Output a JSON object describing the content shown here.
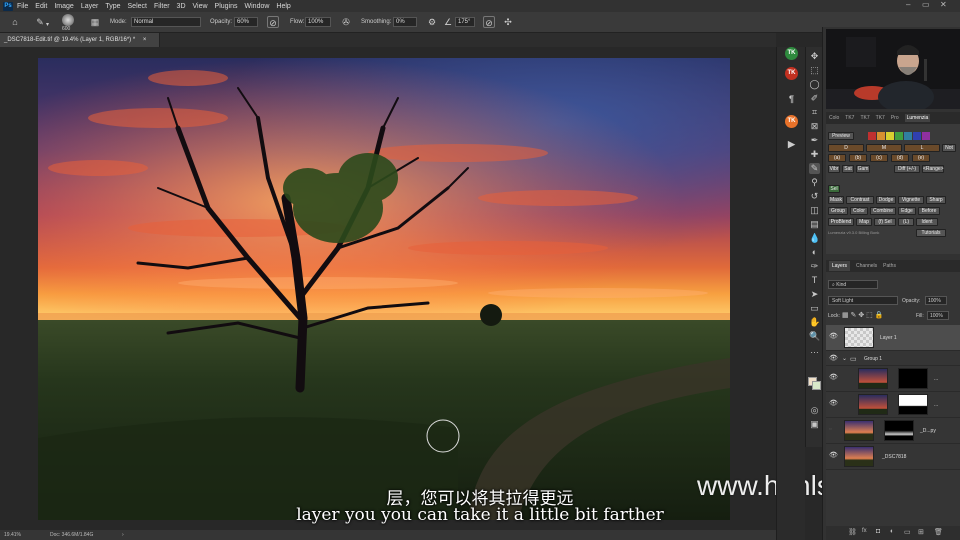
{
  "menubar": {
    "logo": "Ps",
    "items": [
      "File",
      "Edit",
      "Image",
      "Layer",
      "Type",
      "Select",
      "Filter",
      "3D",
      "View",
      "Plugins",
      "Window",
      "Help"
    ]
  },
  "options": {
    "brush_size": "600",
    "mode_label": "Mode:",
    "mode_value": "Normal",
    "opacity_label": "Opacity:",
    "opacity_value": "60%",
    "flow_label": "Flow:",
    "flow_value": "100%",
    "smoothing_label": "Smoothing:",
    "smoothing_value": "0%",
    "angle_value": "175°"
  },
  "document": {
    "tab_title": "_DSC7818-Edit.tif @ 19.4% (Layer 1, RGB/16*) *",
    "close": "×"
  },
  "status": {
    "zoom": "19.41%",
    "doc": "Doc: 346.6M/1.84G"
  },
  "subtitles": {
    "zh": "层，您可以将其拉得更远",
    "en": "layer you you can take it a little bit farther"
  },
  "watermark": "www.hunls.com",
  "plugin_badges": [
    "TK",
    "TK",
    "TK"
  ],
  "lumenzia": {
    "tabs": [
      "Colo",
      "TK7",
      "TK7",
      "TK7",
      "Pro",
      "Lumenzia"
    ],
    "preview_label": "Preview",
    "row2": [
      "D",
      "M",
      "L",
      "Not"
    ],
    "row3": [
      "(a)",
      "(b)",
      "(c)",
      "(d)",
      "(e)"
    ],
    "row4": [
      "Vibr",
      "Sat",
      "Gam",
      "Diff (+/-)",
      "<Range>"
    ],
    "sel_label": "Sel",
    "row6": [
      "Mask",
      "Contrast",
      "Dodge",
      "Vignette",
      "Sharp"
    ],
    "row7": [
      "Group",
      "Color",
      "Combine",
      "Edge",
      "Before"
    ],
    "row8": [
      "ProBlend",
      "Map",
      "(f) Sel",
      "(L)",
      "Ident"
    ],
    "version": "Lumenzia v9.3.0 Billing Bonk",
    "tutorials": "Tutorials"
  },
  "layers_panel": {
    "tabs": [
      "Layers",
      "Channels",
      "Paths"
    ],
    "kind_label": "Kind",
    "blend_mode": "Soft Light",
    "opacity_label": "Opacity:",
    "opacity_value": "100%",
    "lock_label": "Lock:",
    "fill_label": "Fill:",
    "fill_value": "100%",
    "layers": [
      {
        "name": "Layer 1"
      },
      {
        "name": "Group 1"
      },
      {
        "name": "..."
      },
      {
        "name": "..."
      },
      {
        "name": "_D...py"
      },
      {
        "name": "_DSC7818"
      }
    ]
  },
  "colors": {
    "accent": "#31a8ff",
    "panel_bg": "#323232",
    "canvas_bg": "#282828"
  }
}
